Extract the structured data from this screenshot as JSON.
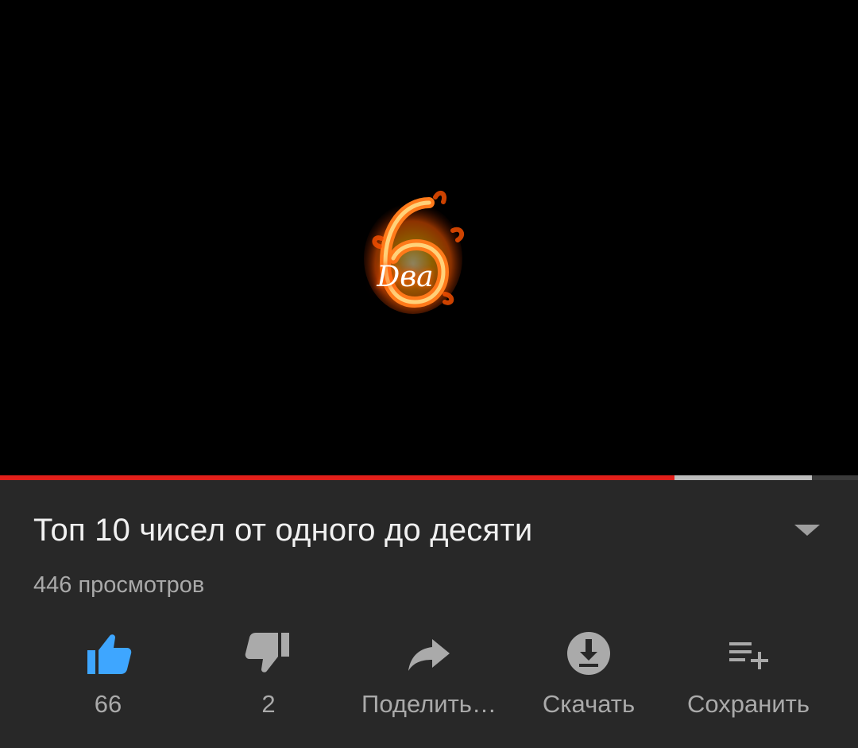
{
  "player": {
    "overlay_text": "Dва",
    "overlay_digit": "6",
    "progress_played_fraction": 0.786,
    "progress_buffered_fraction": 0.946,
    "colors": {
      "played": "#e21f1a",
      "buffered": "#bdbdbd",
      "track": "#3a3a3a"
    }
  },
  "video": {
    "title": "Топ 10 чисел от одного до десяти",
    "views": "446 просмотров"
  },
  "actions": {
    "like": {
      "label": "66",
      "icon": "thumbs-up-icon",
      "active": true,
      "color": "#3ea6ff"
    },
    "dislike": {
      "label": "2",
      "icon": "thumbs-down-icon"
    },
    "share": {
      "label": "Поделить…",
      "icon": "share-arrow-icon"
    },
    "download": {
      "label": "Скачать",
      "icon": "download-icon"
    },
    "save": {
      "label": "Сохранить",
      "icon": "playlist-add-icon"
    }
  }
}
